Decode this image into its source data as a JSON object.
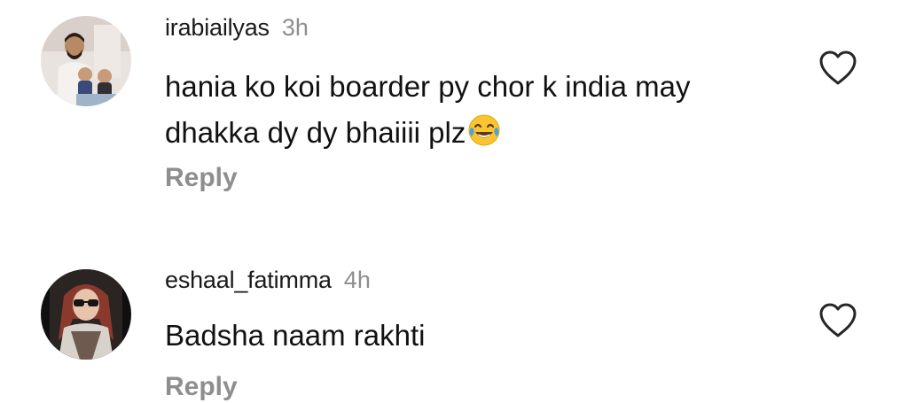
{
  "comments": [
    {
      "username": "irabiailyas",
      "time": "3h",
      "text": "hania ko koi boarder py chor k india may dhakka dy dy bhaiiii plz",
      "emoji": "face-with-tears-of-joy",
      "reply_label": "Reply",
      "liked": false
    },
    {
      "username": "eshaal_fatimma",
      "time": "4h",
      "text": "Badsha naam rakhti",
      "reply_label": "Reply",
      "liked": false
    }
  ],
  "colors": {
    "text": "#111111",
    "muted": "#8e8e8e",
    "background": "#ffffff"
  },
  "icons": {
    "like": "heart-outline-icon"
  }
}
